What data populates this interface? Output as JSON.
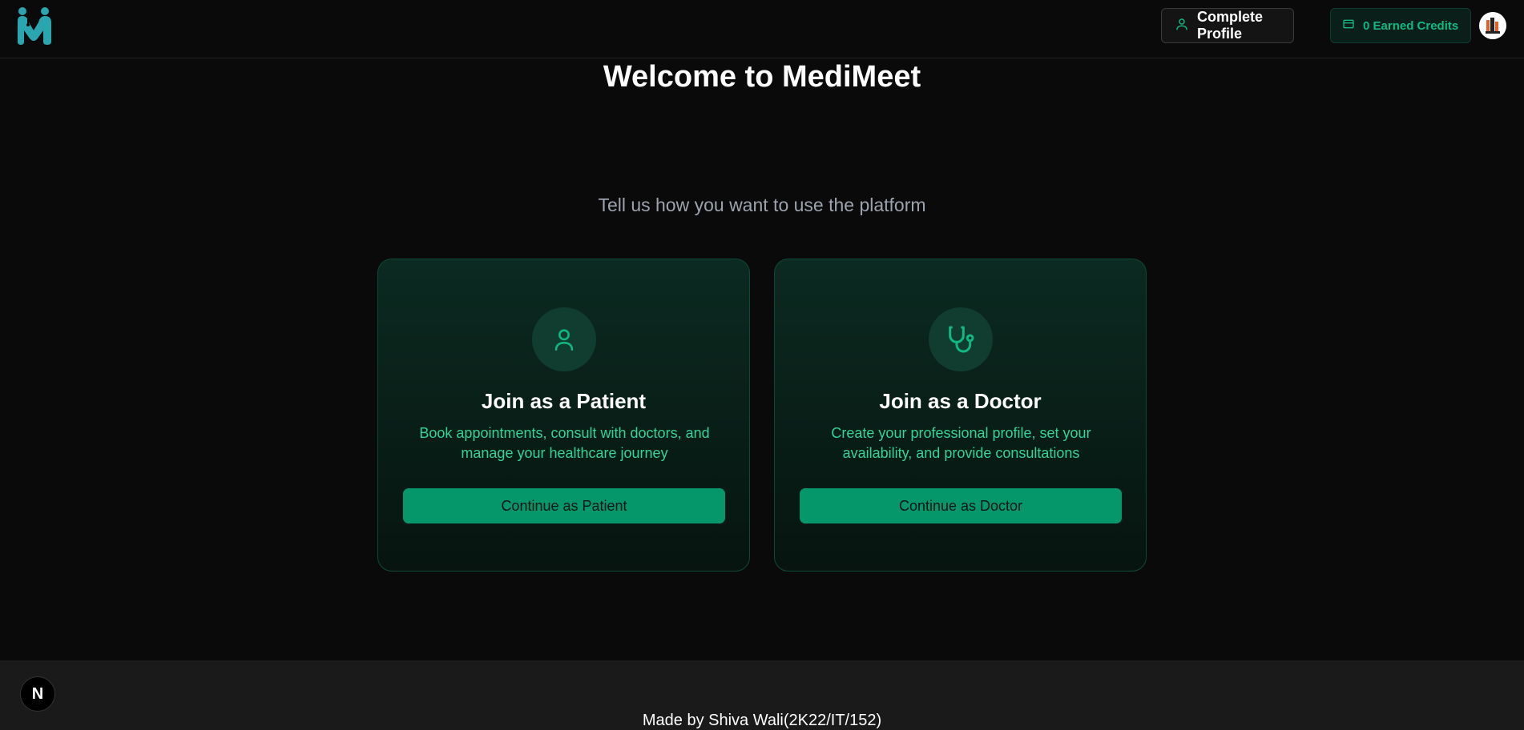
{
  "header": {
    "logo_icon": "medimeet-logo-icon",
    "profile_button_label": "Complete Profile",
    "profile_icon": "user-icon",
    "credits_label": "0 Earned Credits",
    "credits_icon": "credit-card-icon",
    "avatar_icon": "user-avatar"
  },
  "main": {
    "title": "Welcome to MediMeet",
    "subtitle": "Tell us how you want to use the platform",
    "cards": [
      {
        "icon": "user-icon",
        "title": "Join as a Patient",
        "description": "Book appointments, consult with doctors, and manage your healthcare journey",
        "button_label": "Continue as Patient"
      },
      {
        "icon": "stethoscope-icon",
        "title": "Join as a Doctor",
        "description": "Create your professional profile, set your availability, and provide consultations",
        "button_label": "Continue as Doctor"
      }
    ]
  },
  "footer": {
    "text": "Made by Shiva Wali(2K22/IT/152)",
    "badge_label": "N"
  },
  "colors": {
    "background": "#0a0a0a",
    "accent": "#10b981",
    "button": "#059669",
    "card_text": "#34d399",
    "footer_bg": "#1a1a1a"
  }
}
